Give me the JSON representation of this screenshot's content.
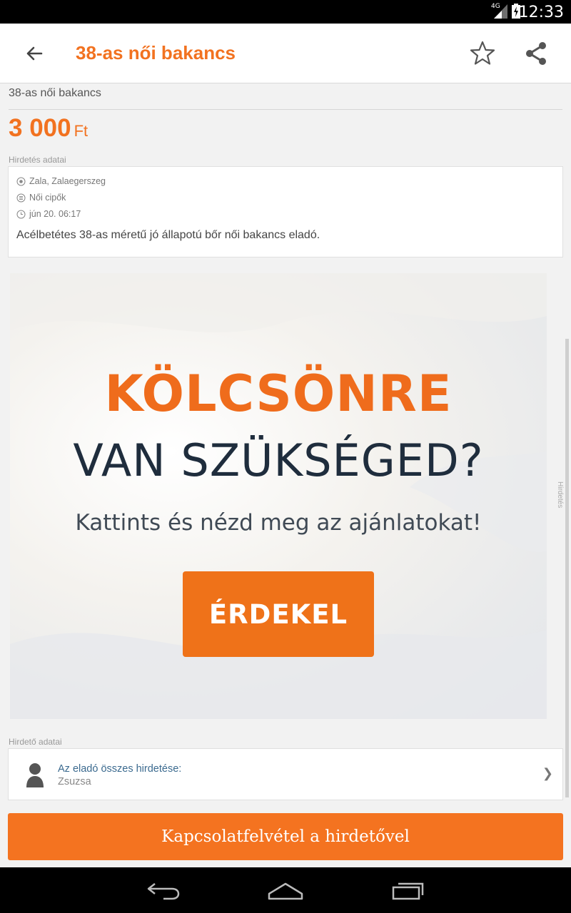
{
  "status_bar": {
    "network": "4G",
    "time": "12:33"
  },
  "app_bar": {
    "title": "38-as női bakancs",
    "back_icon": "arrow-left-icon",
    "favorite_icon": "star-outline-icon",
    "share_icon": "share-icon"
  },
  "ad": {
    "title": "38-as női bakancs",
    "price": "3 000",
    "currency": "Ft",
    "details_label": "Hirdetés adatai",
    "location": "Zala, Zalaegerszeg",
    "category": "Női cipők",
    "date": "jún 20. 06:17",
    "description": "Acélbetétes 38-as méretű jó állapotú bőr női bakancs eladó."
  },
  "banner": {
    "headline1": "KÖLCSÖNRE",
    "headline2": "VAN SZÜKSÉGED?",
    "subline": "Kattints és nézd meg az ajánlatokat!",
    "cta": "ÉRDEKEL",
    "ad_label": "Hirdetés"
  },
  "seller": {
    "section_label": "Hirdető adatai",
    "all_ads_link": "Az eladó összes hirdetése:",
    "name": "Zsuzsa",
    "chevron": "❯"
  },
  "contact_button": "Kapcsolatfelvétel a hirdetővel",
  "colors": {
    "accent": "#f27220",
    "link": "#3b6a8f",
    "banner_dark": "#1f2d3d"
  }
}
